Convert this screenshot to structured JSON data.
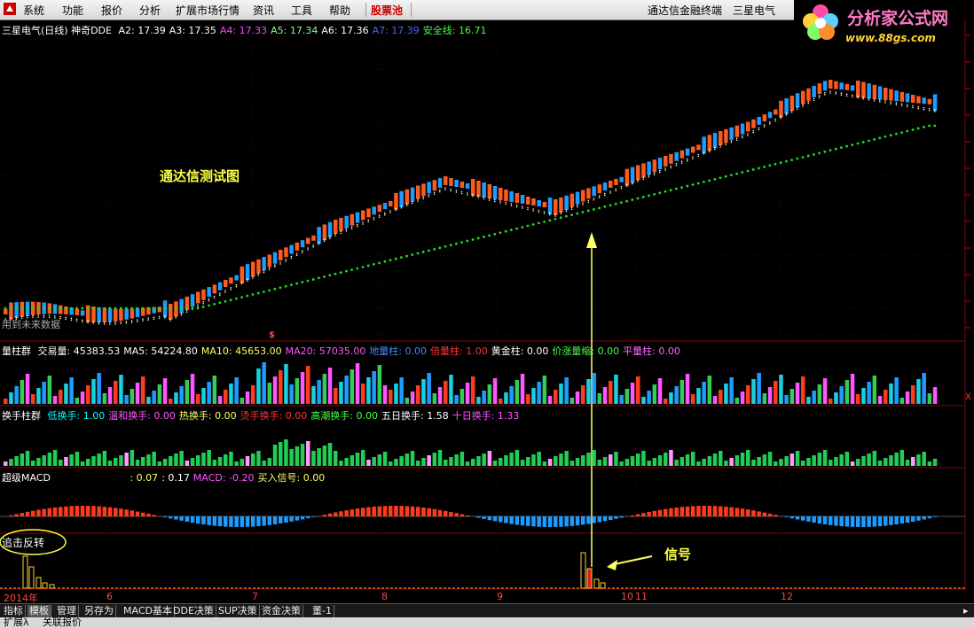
{
  "menu": {
    "items": [
      "系统",
      "功能",
      "报价",
      "分析",
      "扩展市场行情",
      "资讯",
      "工具",
      "帮助"
    ],
    "highlight": "股票池",
    "right_items": [
      "通达信金融终端",
      "三星电气"
    ]
  },
  "brand": {
    "title": "分析家公式网",
    "url": "www.88gs.com"
  },
  "main_panel": {
    "title": "三星电气(日线) 神奇DDE",
    "indicators": [
      {
        "label": "A2: 17.39",
        "color": "#ffffff"
      },
      {
        "label": "A3: 17.35",
        "color": "#ffffff"
      },
      {
        "label": "A4: 17.33",
        "color": "#ff44ff"
      },
      {
        "label": "A5: 17.34",
        "color": "#88ff88"
      },
      {
        "label": "A6: 17.36",
        "color": "#ffffff"
      },
      {
        "label": "A7: 17.39",
        "color": "#4466ff"
      },
      {
        "label": "安全线: 16.71",
        "color": "#44ff44"
      }
    ],
    "test_label": "通达信测试图",
    "future_label": "用到未来数据",
    "dollar_mark": "$"
  },
  "volume_panel": {
    "title": "量柱群",
    "items": [
      {
        "label": "交易量: 45383.53",
        "color": "#ffffff"
      },
      {
        "label": "MA5: 54224.80",
        "color": "#ffffff"
      },
      {
        "label": "MA10: 45653.00",
        "color": "#ffff66"
      },
      {
        "label": "MA20: 57035.00",
        "color": "#ff55ff"
      },
      {
        "label": "地量柱: 0.00",
        "color": "#4488ff"
      },
      {
        "label": "倍量柱: 1.00",
        "color": "#ff3333"
      },
      {
        "label": "黄金柱: 0.00",
        "color": "#ffffff"
      },
      {
        "label": "价涨量缩: 0.00",
        "color": "#44ff44"
      },
      {
        "label": "平量柱: 0.00",
        "color": "#ff66ff"
      }
    ],
    "close_mark": "X"
  },
  "turnover_panel": {
    "title": "换手柱群",
    "items": [
      {
        "label": "低换手: 1.00",
        "color": "#00ffff"
      },
      {
        "label": "温和换手: 0.00",
        "color": "#ff55ff"
      },
      {
        "label": "热换手: 0.00",
        "color": "#ffff66"
      },
      {
        "label": "烫手换手: 0.00",
        "color": "#ff3333"
      },
      {
        "label": "高潮换手: 0.00",
        "color": "#44ff44"
      },
      {
        "label": "五日换手: 1.58",
        "color": "#ffffff"
      },
      {
        "label": "十日换手: 1.33",
        "color": "#ff55ff"
      }
    ]
  },
  "macd_panel": {
    "title": "超级MACD",
    "items": [
      {
        "label": ": 0.07",
        "color": "#ffff66"
      },
      {
        "label": ": 0.17",
        "color": "#ffffff"
      },
      {
        "label": "MACD: -0.20",
        "color": "#ff55ff"
      },
      {
        "label": "买入信号: 0.00",
        "color": "#ffff66"
      }
    ]
  },
  "reversal_panel": {
    "title": "追击反转",
    "signal_label": "信号"
  },
  "time_axis": [
    "2014年",
    "6",
    "7",
    "8",
    "9",
    "10",
    "11",
    "12"
  ],
  "bottom_tabs": [
    "指标",
    "模板",
    "管理",
    "另存为",
    "MACD基本",
    "DDE决策",
    "SUP决策",
    "资金决策",
    "董-1"
  ],
  "status_tabs": [
    "扩展λ",
    "关联报价"
  ],
  "colors": {
    "up_candle": "#ff5a1e",
    "down_candle": "#1e9bff",
    "safety_line": "#22dd22",
    "signal_arrow": "#ffff66",
    "grid": "#8b0000"
  }
}
